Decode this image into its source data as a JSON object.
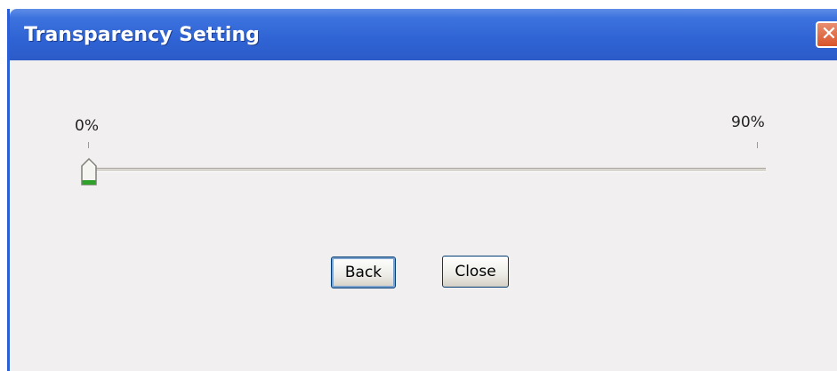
{
  "window": {
    "title": "Transparency Setting",
    "close_glyph": "✕"
  },
  "slider": {
    "min_label": "0%",
    "max_label": "90%",
    "value_fraction": 0.0,
    "thumb_color": "#2fa02a"
  },
  "buttons": {
    "back_label": "Back",
    "close_label": "Close"
  },
  "colors": {
    "titlebar": "#2f63d4",
    "background": "#f1eff0",
    "close_button": "#d7542a"
  }
}
